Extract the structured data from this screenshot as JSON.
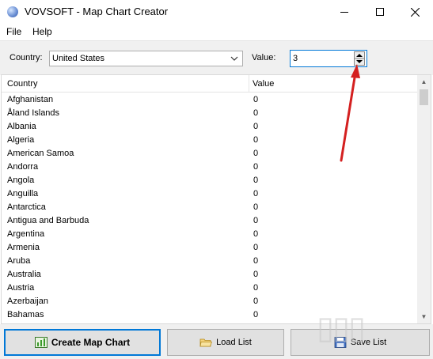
{
  "window": {
    "title": "VOVSOFT - Map Chart Creator"
  },
  "menu": {
    "items": [
      "File",
      "Help"
    ]
  },
  "toolbar": {
    "country_label": "Country:",
    "country_value": "United States",
    "value_label": "Value:",
    "value_value": "3"
  },
  "list": {
    "columns": [
      "Country",
      "Value"
    ],
    "rows": [
      [
        "Afghanistan",
        "0"
      ],
      [
        "Åland Islands",
        "0"
      ],
      [
        "Albania",
        "0"
      ],
      [
        "Algeria",
        "0"
      ],
      [
        "American Samoa",
        "0"
      ],
      [
        "Andorra",
        "0"
      ],
      [
        "Angola",
        "0"
      ],
      [
        "Anguilla",
        "0"
      ],
      [
        "Antarctica",
        "0"
      ],
      [
        "Antigua and Barbuda",
        "0"
      ],
      [
        "Argentina",
        "0"
      ],
      [
        "Armenia",
        "0"
      ],
      [
        "Aruba",
        "0"
      ],
      [
        "Australia",
        "0"
      ],
      [
        "Austria",
        "0"
      ],
      [
        "Azerbaijan",
        "0"
      ],
      [
        "Bahamas",
        "0"
      ]
    ]
  },
  "buttons": {
    "create": "Create Map Chart",
    "load": "Load List",
    "save": "Save List"
  },
  "colors": {
    "accent": "#0078d7",
    "annotation": "#d42020"
  }
}
